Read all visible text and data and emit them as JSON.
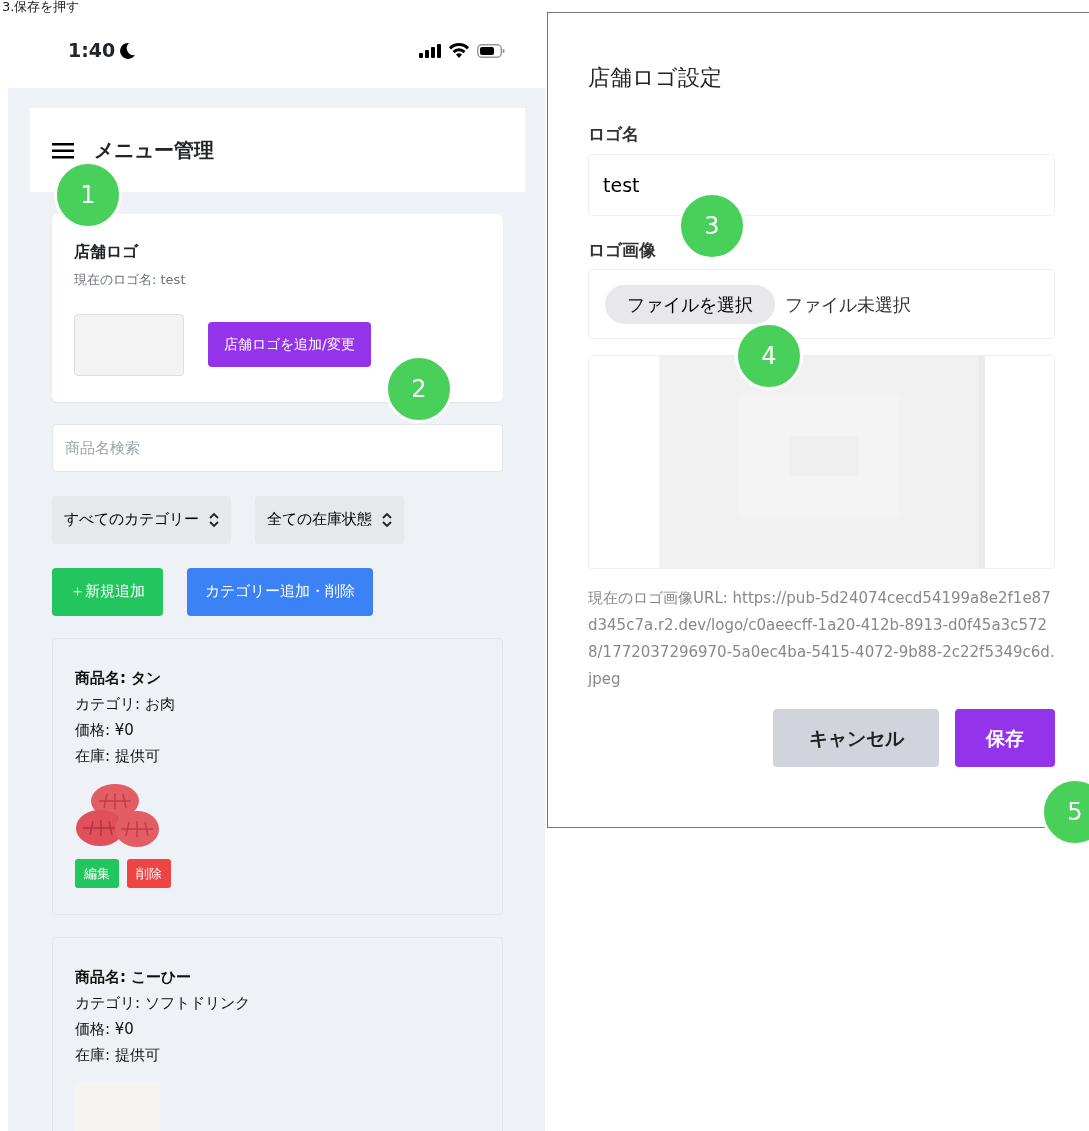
{
  "caption": "3.保存を押す",
  "phone": {
    "status_bar": {
      "time": "1:40"
    },
    "header": {
      "title": "メニュー管理"
    },
    "logo_card": {
      "title": "店舗ロゴ",
      "current": "現在のロゴ名: test",
      "button": "店舗ロゴを追加/変更"
    },
    "search": {
      "placeholder": "商品名検索"
    },
    "filters": [
      {
        "label": "すべてのカテゴリー"
      },
      {
        "label": "全ての在庫状態"
      }
    ],
    "actions": [
      {
        "label": "＋新規追加",
        "color": "#22c55e"
      },
      {
        "label": "カテゴリー追加・削除",
        "color": "#3b82f6"
      }
    ],
    "products": [
      {
        "name": "商品名: タン",
        "category": "カテゴリ: お肉",
        "price": "価格: ¥0",
        "stock": "在庫: 提供可",
        "kind": "meat",
        "buttons": [
          {
            "label": "編集",
            "color": "#22c55e"
          },
          {
            "label": "削除",
            "color": "#ef4444"
          }
        ]
      },
      {
        "name": "商品名: こーひー",
        "category": "カテゴリ: ソフトドリンク",
        "price": "価格: ¥0",
        "stock": "在庫: 提供可",
        "kind": "blank"
      }
    ]
  },
  "dialog": {
    "title": "店舗ロゴ設定",
    "name_field": {
      "label": "ロゴ名",
      "value": "test"
    },
    "image_field": {
      "label": "ロゴ画像",
      "button": "ファイルを選択",
      "status": "ファイル未選択"
    },
    "url_text": "現在のロゴ画像URL: https://pub-5d24074cecd54199a8e2f1e87d345c7a.r2.dev/logo/c0aeecff-1a20-412b-8913-d0f45a3c5728/1772037296970-5a0ec4ba-5415-4072-9b88-2c22f5349c6d.jpeg",
    "buttons": [
      {
        "label": "キャンセル",
        "kind": "secondary"
      },
      {
        "label": "保存",
        "kind": "primary"
      }
    ]
  },
  "callouts": [
    {
      "label": "1"
    },
    {
      "label": "2"
    },
    {
      "label": "3"
    },
    {
      "label": "4"
    },
    {
      "label": "5"
    }
  ]
}
